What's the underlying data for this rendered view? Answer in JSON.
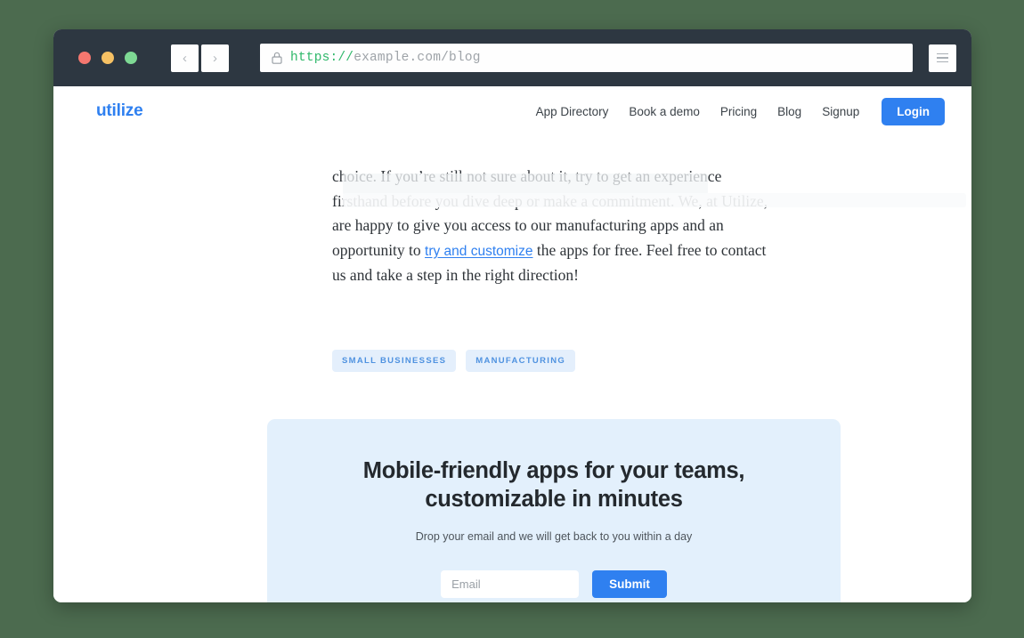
{
  "browser": {
    "traffic_lights": [
      "close",
      "minimize",
      "maximize"
    ],
    "back_label": "‹",
    "forward_label": "›",
    "url_scheme": "https://",
    "url_rest": "example.com/blog",
    "url_full": "https://example.com/blog",
    "menu_label": "menu"
  },
  "site": {
    "logo": "utilize",
    "nav": [
      {
        "label": "App Directory"
      },
      {
        "label": "Book a demo"
      },
      {
        "label": "Pricing"
      },
      {
        "label": "Blog"
      },
      {
        "label": "Signup"
      }
    ],
    "login_label": "Login"
  },
  "article": {
    "para_part1": "choice. If you’re still not sure about it, try to get an experience firsthand before you dive deep or make a commitment. We, at Utilize, are happy to give you access to our manufacturing apps and an opportunity to ",
    "link_text": "try and customize",
    "para_part2": " the apps for free. Feel free to contact us and take a step in the right direction!"
  },
  "tags": [
    {
      "label": "Small Businesses"
    },
    {
      "label": "Manufacturing"
    }
  ],
  "cta": {
    "title": "Mobile-friendly apps for your teams, customizable in minutes",
    "subtitle": "Drop your email and we will get back to you within a day",
    "email_placeholder": "Email",
    "email_value": "",
    "submit_label": "Submit"
  },
  "colors": {
    "desktop_background": "#4c6b4f",
    "chrome": "#2d3741",
    "accent_blue": "#2f80f0",
    "card_background": "#e3f0fc",
    "tag_background": "#e4effc",
    "tag_text": "#4f92e0",
    "url_scheme_green": "#2fb86a"
  }
}
